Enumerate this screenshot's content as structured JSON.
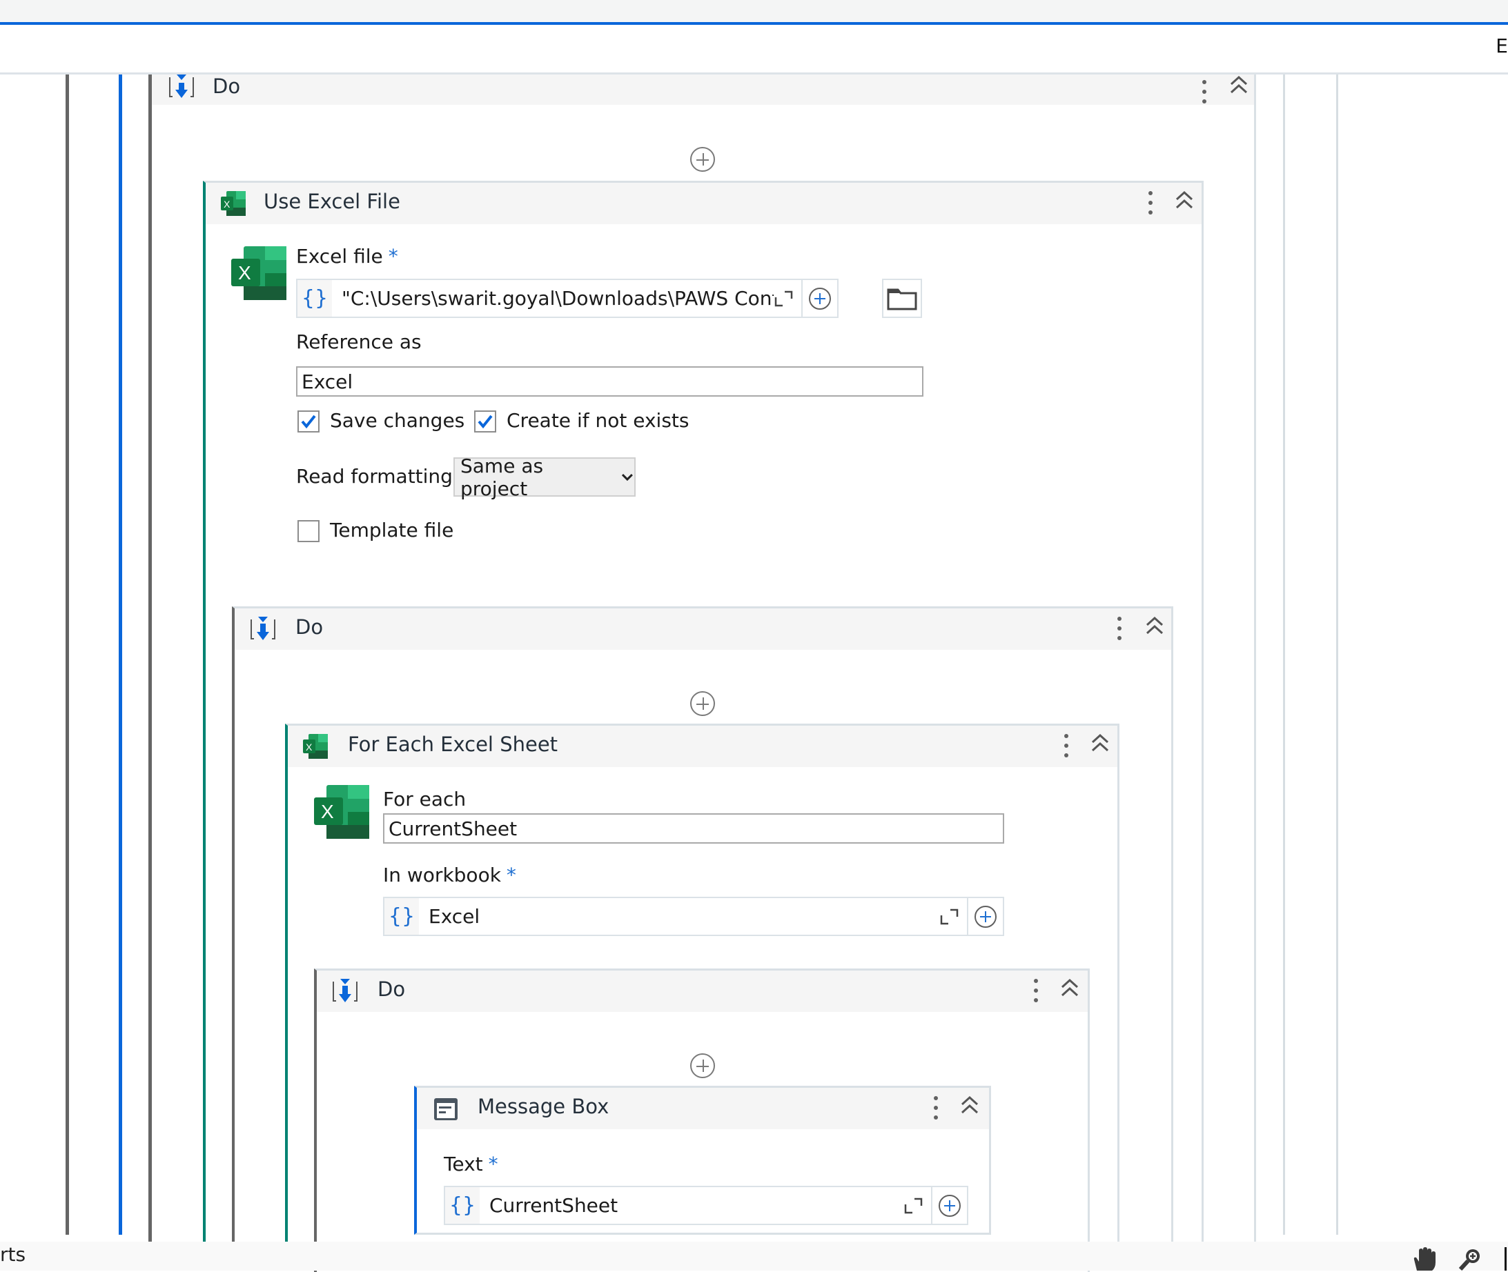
{
  "header": {
    "right_text": "E"
  },
  "outer_sequence": {
    "title": "Do"
  },
  "use_excel_file": {
    "title": "Use Excel File",
    "excel_file_label": "Excel file",
    "required_mark": "*",
    "excel_file_value": "\"C:\\Users\\swarit.goyal\\Downloads\\PAWS Confirma",
    "reference_as_label": "Reference as",
    "reference_as_value": "Excel",
    "save_changes_label": "Save changes",
    "save_changes_checked": true,
    "create_if_not_exists_label": "Create if not exists",
    "create_if_not_exists_checked": true,
    "read_formatting_label": "Read formatting",
    "read_formatting_value": "Same as project",
    "template_file_label": "Template file",
    "template_file_checked": false
  },
  "inner_sequence": {
    "title": "Do"
  },
  "for_each_sheet": {
    "title": "For Each Excel Sheet",
    "for_each_label": "For each",
    "for_each_value": "CurrentSheet",
    "in_workbook_label": "In workbook",
    "required_mark": "*",
    "in_workbook_value": "Excel"
  },
  "loop_body": {
    "title": "Do"
  },
  "message_box": {
    "title": "Message Box",
    "text_label": "Text",
    "required_mark": "*",
    "text_value": "CurrentSheet"
  },
  "status_bar": {
    "left_text": "rts"
  },
  "colors": {
    "accent_blue": "#0a66da",
    "excel_green": "#107c41",
    "teal_border": "#008272",
    "grey_border": "#666666"
  }
}
